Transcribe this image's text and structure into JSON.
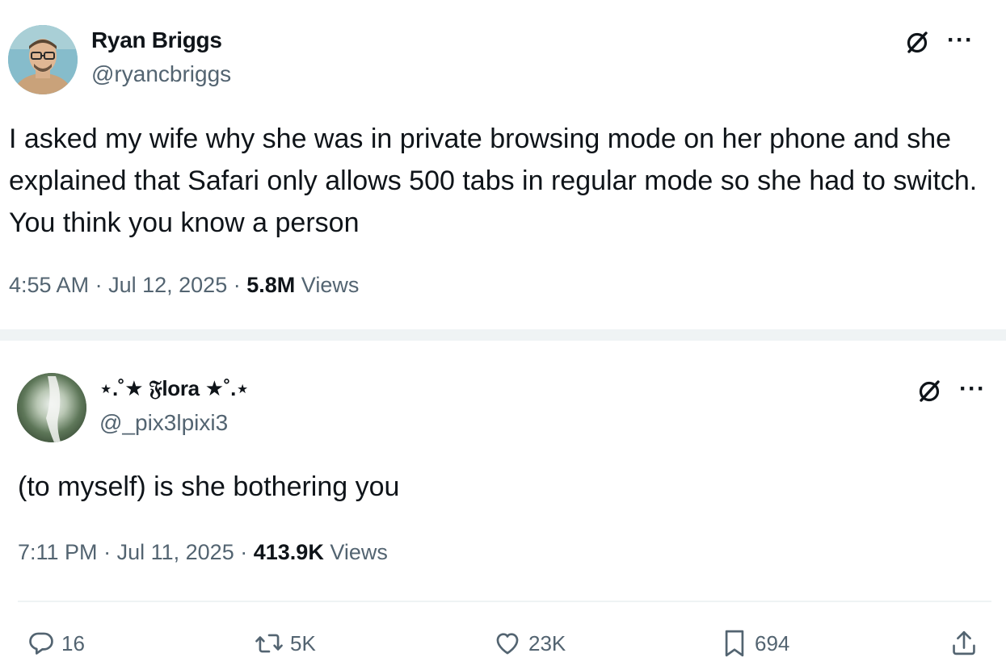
{
  "tweet_main": {
    "display_name": "Ryan Briggs",
    "handle": "@ryancbriggs",
    "text": "I asked my wife why she was in private browsing mode on her phone and she explained that Safari only allows 500 tabs in regular mode so she had to switch. You think you know a person",
    "time": "4:55 AM",
    "date": "Jul 12, 2025",
    "views_count": "5.8M",
    "views_label": "Views",
    "separator": "·",
    "avatar_icon": "avatar-man-glasses",
    "grok_icon": "grok-slash-icon",
    "more_icon": "more-icon"
  },
  "tweet_reply": {
    "display_name": "⋆.˚★ 𝔉lora ★˚.⋆",
    "handle": "@_pix3lpixi3",
    "text": "(to myself) is she bothering you",
    "time": "7:11 PM",
    "date": "Jul 11, 2025",
    "views_count": "413.9K",
    "views_label": "Views",
    "separator": "·",
    "avatar_icon": "avatar-blurred-photo",
    "actions": {
      "replies": "16",
      "reposts": "5K",
      "likes": "23K",
      "bookmarks": "694"
    }
  },
  "colors": {
    "text_primary": "#0f1419",
    "text_secondary": "#536471",
    "divider": "#eff3f4"
  }
}
